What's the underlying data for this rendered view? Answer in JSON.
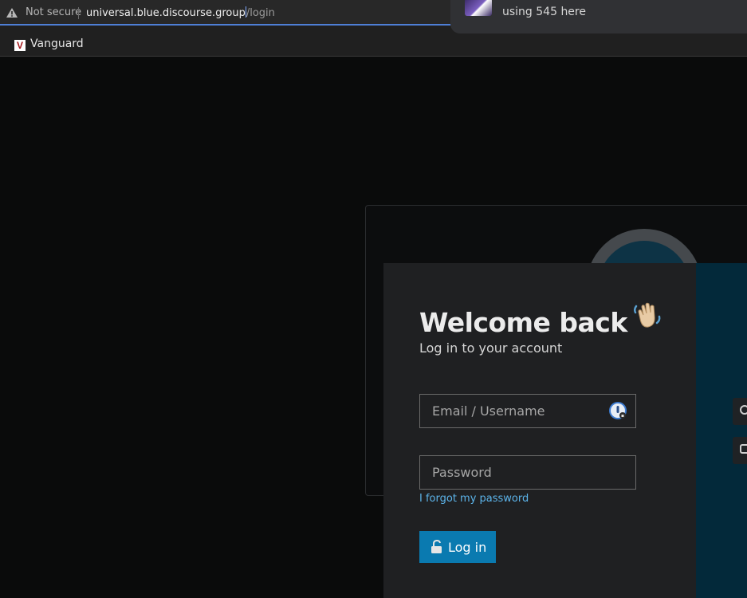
{
  "browser": {
    "security_label": "Not secure",
    "url_host": "universal.blue.discourse.group",
    "url_path": "/login",
    "bookmark_label": "Vanguard",
    "bookmark_logo_letter": "V",
    "notification_text": "using 545 here"
  },
  "login": {
    "title": "Welcome back",
    "wave_icon": "waving-hand-icon",
    "subtitle": "Log in to your account",
    "username_placeholder": "Email / Username",
    "password_placeholder": "Password",
    "forgot_label": "I forgot my password",
    "login_button_label": "Log in"
  },
  "colors": {
    "primary_button": "#0a7ab0",
    "link": "#5cb4ea",
    "side_panel": "#03293a",
    "modal_bg": "#1f2022"
  }
}
